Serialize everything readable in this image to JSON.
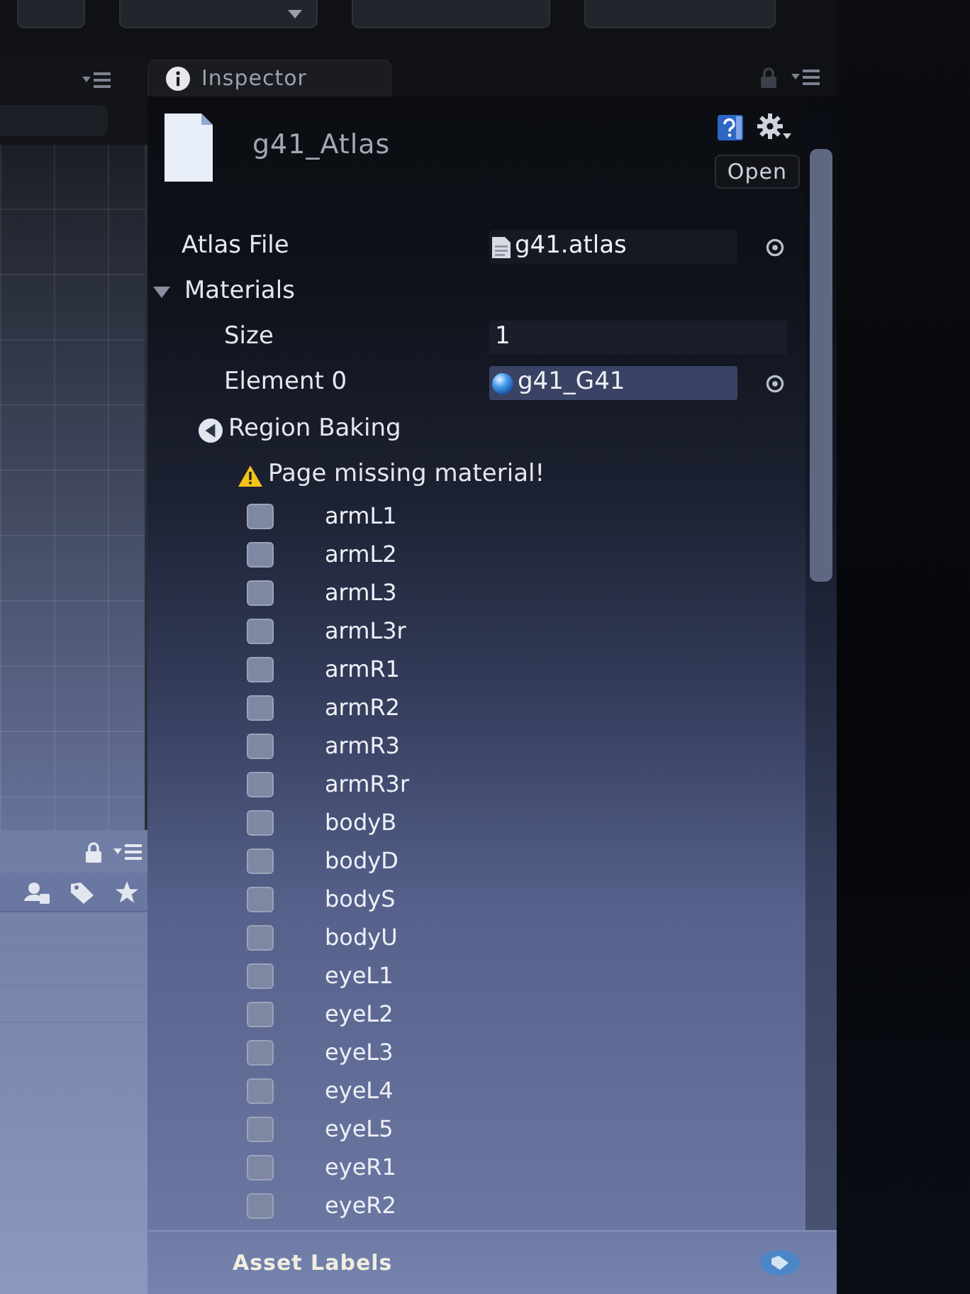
{
  "inspector": {
    "tab": {
      "label": "Inspector",
      "selected": true
    },
    "asset": {
      "name": "g41_Atlas",
      "open_button": "Open"
    },
    "properties": [
      {
        "kind": "file_field",
        "label": "Atlas File",
        "value": "g41.atlas"
      },
      {
        "kind": "foldout",
        "label": "Materials",
        "expanded": true,
        "children": [
          {
            "kind": "int_field",
            "label": "Size",
            "value": "1"
          },
          {
            "kind": "material_field",
            "label": "Element 0",
            "value": "g41_G41"
          }
        ]
      }
    ],
    "region_baking": {
      "title": "Region Baking",
      "warning": "Page missing material!",
      "regions": [
        {
          "name": "armL1",
          "checked": false
        },
        {
          "name": "armL2",
          "checked": false
        },
        {
          "name": "armL3",
          "checked": false
        },
        {
          "name": "armL3r",
          "checked": false
        },
        {
          "name": "armR1",
          "checked": false
        },
        {
          "name": "armR2",
          "checked": false
        },
        {
          "name": "armR3",
          "checked": false
        },
        {
          "name": "armR3r",
          "checked": false
        },
        {
          "name": "bodyB",
          "checked": false
        },
        {
          "name": "bodyD",
          "checked": false
        },
        {
          "name": "bodyS",
          "checked": false
        },
        {
          "name": "bodyU",
          "checked": false
        },
        {
          "name": "eyeL1",
          "checked": false
        },
        {
          "name": "eyeL2",
          "checked": false
        },
        {
          "name": "eyeL3",
          "checked": false
        },
        {
          "name": "eyeL4",
          "checked": false
        },
        {
          "name": "eyeL5",
          "checked": false
        },
        {
          "name": "eyeR1",
          "checked": false
        },
        {
          "name": "eyeR2",
          "checked": false
        }
      ]
    },
    "asset_labels": {
      "title": "Asset Labels"
    }
  }
}
